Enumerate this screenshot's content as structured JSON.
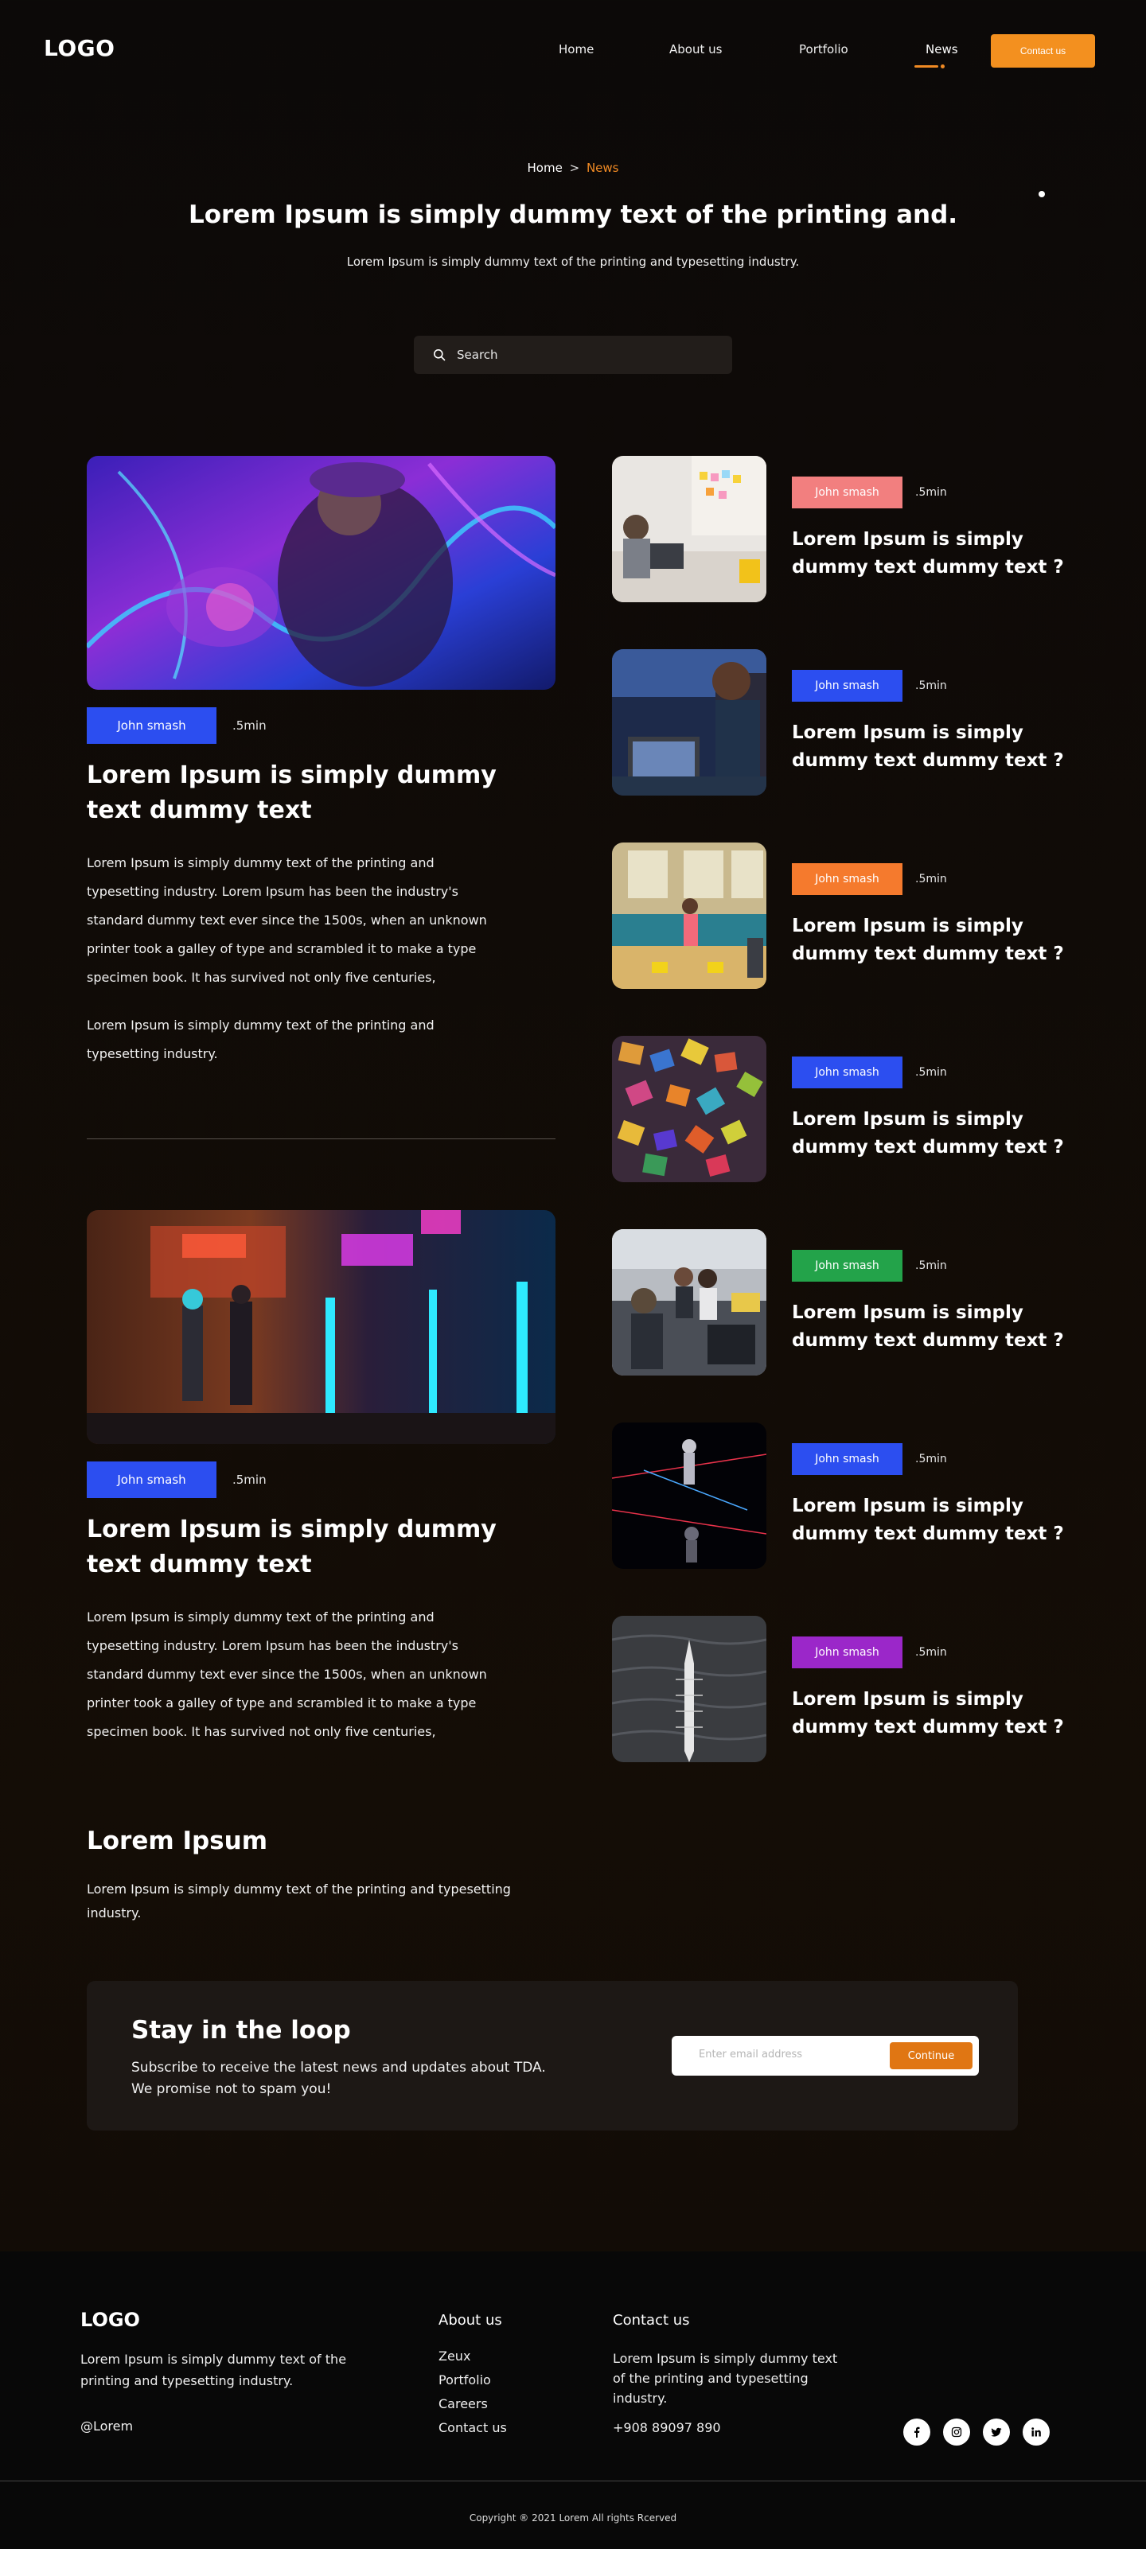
{
  "header": {
    "logo": "LOGO",
    "nav": [
      "Home",
      "About us",
      "Portfolio",
      "News"
    ],
    "active_nav": "News",
    "contact_button": "Contact us",
    "accent_color": "#f3901f"
  },
  "hero": {
    "breadcrumb": {
      "home": "Home",
      "separator": ">",
      "current": "News"
    },
    "title": "Lorem Ipsum is simply dummy text of the printing and.",
    "subtitle": "Lorem Ipsum is simply dummy text of the printing and typesetting industry."
  },
  "search": {
    "placeholder": "Search",
    "icon": "search-icon"
  },
  "featured": [
    {
      "tag": "John smash",
      "tag_color": "#2c4ef0",
      "read_time": ".5min",
      "title": "Lorem Ipsum is simply dummy text dummy text",
      "body": "Lorem Ipsum is simply dummy text of the printing and typesetting industry. Lorem Ipsum has been the industry's standard dummy text ever since the 1500s, when an unknown printer took a galley of type and scrambled it to make a type specimen book. It has survived not only five centuries,",
      "body2": "Lorem Ipsum is simply dummy text of the printing and typesetting industry."
    },
    {
      "tag": "John smash",
      "tag_color": "#2c4ef0",
      "read_time": ".5min",
      "title": "Lorem Ipsum is simply dummy text dummy text",
      "body": "Lorem Ipsum is simply dummy text of the printing and typesetting industry. Lorem Ipsum has been the industry's standard dummy text ever since the 1500s, when an unknown printer took a galley of type and scrambled it to make a type specimen book. It has survived not only five centuries,"
    }
  ],
  "side_articles": [
    {
      "tag": "John smash",
      "tag_color": "#f27f7f",
      "read_time": ".5min",
      "title": "Lorem Ipsum is simply dummy text dummy text ?"
    },
    {
      "tag": "John smash",
      "tag_color": "#2c4ef0",
      "read_time": ".5min",
      "title": "Lorem Ipsum is simply dummy text dummy text ?"
    },
    {
      "tag": "John smash",
      "tag_color": "#f57a2d",
      "read_time": ".5min",
      "title": "Lorem Ipsum is simply dummy text dummy text ?"
    },
    {
      "tag": "John smash",
      "tag_color": "#2c4ef0",
      "read_time": ".5min",
      "title": "Lorem Ipsum is simply dummy text dummy text ?"
    },
    {
      "tag": "John smash",
      "tag_color": "#23a34a",
      "read_time": ".5min",
      "title": "Lorem Ipsum is simply dummy text dummy text ?"
    },
    {
      "tag": "John smash",
      "tag_color": "#2c4ef0",
      "read_time": ".5min",
      "title": "Lorem Ipsum is simply dummy text dummy text ?"
    },
    {
      "tag": "John smash",
      "tag_color": "#9b27c9",
      "read_time": ".5min",
      "title": "Lorem Ipsum is simply dummy text dummy text ?"
    }
  ],
  "lorem_section": {
    "title": "Lorem Ipsum",
    "text": "Lorem Ipsum is simply dummy text of the printing and typesetting industry."
  },
  "newsletter": {
    "title": "Stay in the loop",
    "text": "Subscribe to receive the latest news and updates about TDA. We promise not to spam you!",
    "placeholder": "Enter email address",
    "button": "Continue"
  },
  "footer": {
    "logo": "LOGO",
    "about": "Lorem Ipsum is simply dummy text of the printing and typesetting industry.",
    "handle": "@Lorem",
    "about_title": "About us",
    "about_links": [
      "Zeux",
      "Portfolio",
      "Careers",
      "Contact us"
    ],
    "contact_title": "Contact us",
    "contact_text": "Lorem Ipsum is simply dummy text of the printing and typesetting industry.",
    "phone": "+908 89097 890",
    "social": [
      "facebook-icon",
      "instagram-icon",
      "twitter-icon",
      "linkedin-icon"
    ],
    "copyright": "Copyright ® 2021 Lorem All rights Rcerved"
  }
}
